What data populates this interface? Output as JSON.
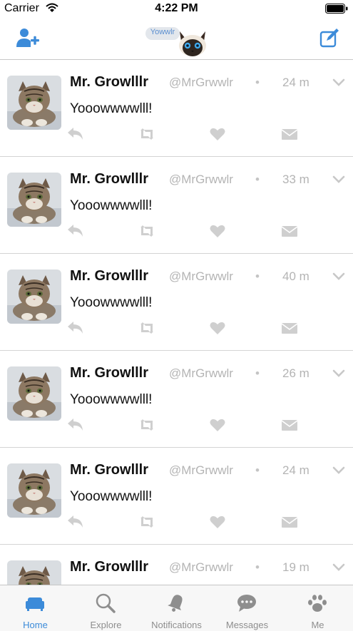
{
  "status_bar": {
    "carrier": "Carrier",
    "time": "4:22 PM"
  },
  "header": {
    "logo_text": "Yowwlr",
    "left_icon": "add-user-icon",
    "right_icon": "compose-icon"
  },
  "colors": {
    "accent": "#3c8bd9",
    "muted_icon": "#cfcfcf",
    "secondary_text": "#b4b4b4"
  },
  "tweets": [
    {
      "name": "Mr. Growlllr",
      "handle": "@MrGrwwlr",
      "separator": "•",
      "time": "24 m",
      "text": "Yooowwwwlll!"
    },
    {
      "name": "Mr. Growlllr",
      "handle": "@MrGrwwlr",
      "separator": "•",
      "time": "33 m",
      "text": "Yooowwwwlll!"
    },
    {
      "name": "Mr. Growlllr",
      "handle": "@MrGrwwlr",
      "separator": "•",
      "time": "40 m",
      "text": "Yooowwwwlll!"
    },
    {
      "name": "Mr. Growlllr",
      "handle": "@MrGrwwlr",
      "separator": "•",
      "time": "26 m",
      "text": "Yooowwwwlll!"
    },
    {
      "name": "Mr. Growlllr",
      "handle": "@MrGrwwlr",
      "separator": "•",
      "time": "24 m",
      "text": "Yooowwwwlll!"
    },
    {
      "name": "Mr. Growlllr",
      "handle": "@MrGrwwlr",
      "separator": "•",
      "time": "19 m",
      "text": ""
    }
  ],
  "tweet_actions": [
    "reply-icon",
    "retweet-icon",
    "like-icon",
    "message-icon"
  ],
  "tabs": [
    {
      "label": "Home",
      "icon": "sofa-icon",
      "active": true
    },
    {
      "label": "Explore",
      "icon": "magnifier-icon",
      "active": false
    },
    {
      "label": "Notifications",
      "icon": "bell-icon",
      "active": false
    },
    {
      "label": "Messages",
      "icon": "chat-bubble-icon",
      "active": false
    },
    {
      "label": "Me",
      "icon": "paw-icon",
      "active": false
    }
  ]
}
